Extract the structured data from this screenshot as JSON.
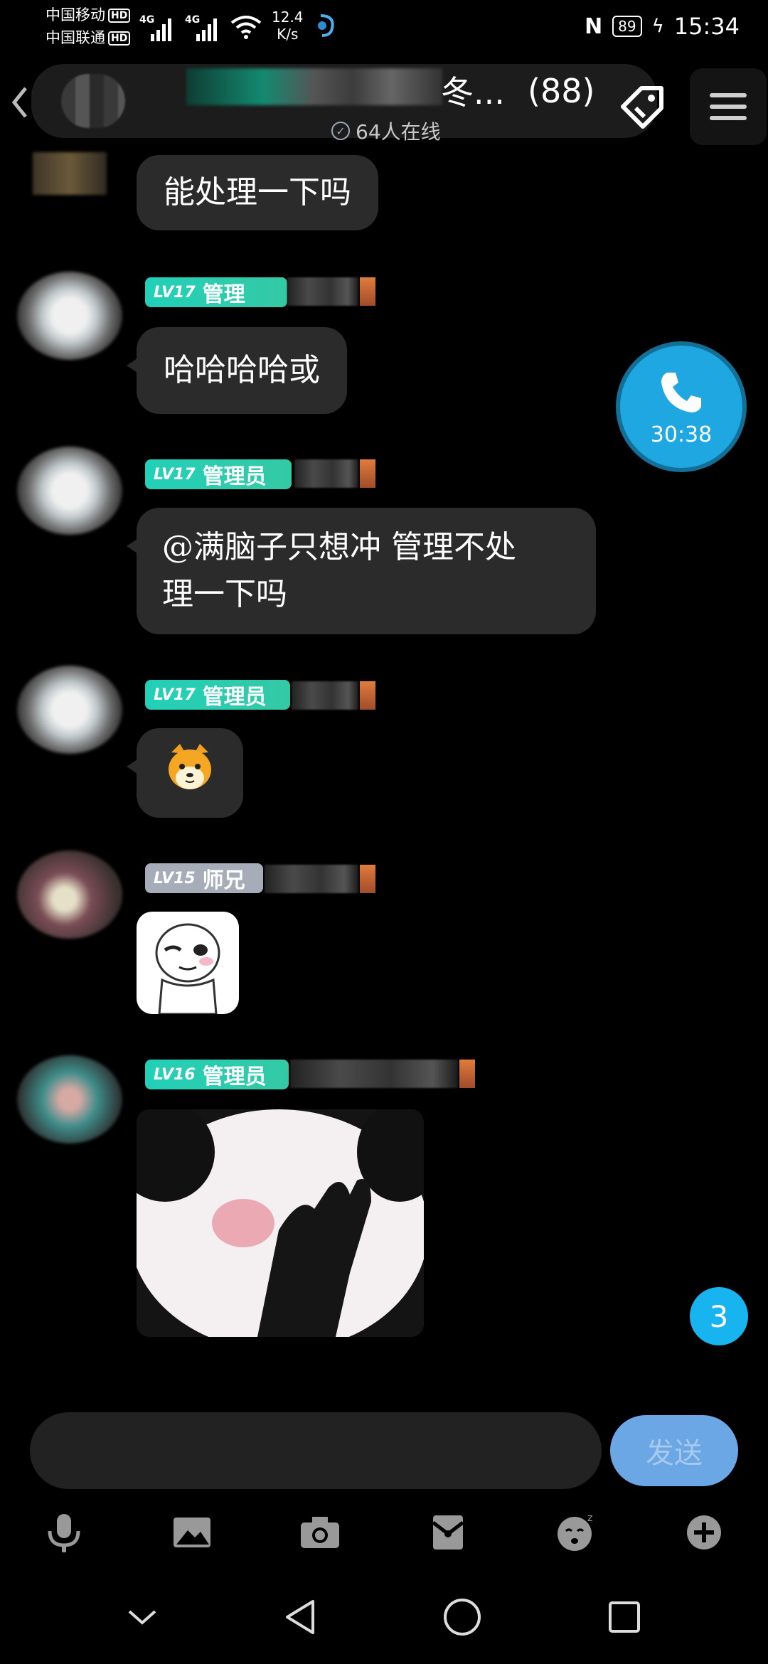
{
  "status_bar": {
    "carrier1": "中国移动",
    "carrier2": "中国联通",
    "hd": "HD",
    "net1": "4G",
    "net2": "4G",
    "speed_value": "12.4",
    "speed_unit": "K/s",
    "battery": "89",
    "time": "15:34"
  },
  "header": {
    "title_suffix": "冬...",
    "member_count": "(88)",
    "online": "64人在线"
  },
  "messages": [
    {
      "text": "能处理一下吗"
    },
    {
      "badge_level": "LV17",
      "badge_role": "管理",
      "text": "哈哈哈哈或"
    },
    {
      "badge_level": "LV17",
      "badge_role": "管理员",
      "text_line1": "@满脑子只想冲 管理不处",
      "text_line2": "理一下吗"
    },
    {
      "badge_level": "LV17",
      "badge_role": "管理员"
    },
    {
      "badge_level": "LV15",
      "badge_role": "师兄"
    },
    {
      "badge_level": "LV16",
      "badge_role": "管理员"
    }
  ],
  "call": {
    "timer": "30:38"
  },
  "unread_count": "3",
  "composer": {
    "placeholder": "",
    "send_label": "发送"
  },
  "icons": [
    "back-icon",
    "tag-icon",
    "menu-icon",
    "phone-icon",
    "mic-icon",
    "image-icon",
    "camera-icon",
    "envelope-icon",
    "emoji-icon",
    "plus-icon",
    "nav-down-icon",
    "nav-back-icon",
    "nav-home-icon",
    "nav-recents-icon"
  ]
}
